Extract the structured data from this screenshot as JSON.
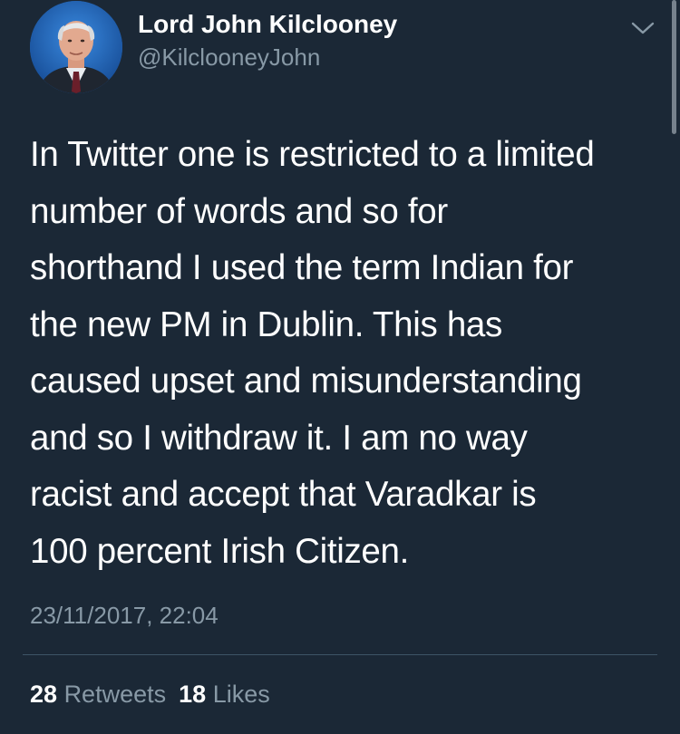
{
  "author": {
    "name": "Lord John Kilclooney",
    "handle": "@KilclooneyJohn"
  },
  "tweet": {
    "lines": [
      "In Twitter one is restricted to a limited",
      "number of words and so for",
      "shorthand I used the term Indian for",
      "the new PM in Dublin. This has",
      "caused upset and misunderstanding",
      "and so I withdraw it. I am no way",
      "racist and accept that Varadkar is",
      "100 percent Irish Citizen."
    ],
    "timestamp": "23/11/2017, 22:04"
  },
  "stats": {
    "retweets_count": "28",
    "retweets_label": "Retweets",
    "likes_count": "18",
    "likes_label": "Likes"
  },
  "icons": {
    "menu": "chevron-down-icon",
    "avatar": "profile-photo"
  },
  "colors": {
    "background": "#1b2836",
    "primary_text": "#ffffff",
    "secondary_text": "#8899a6",
    "divider": "#3d5466"
  }
}
